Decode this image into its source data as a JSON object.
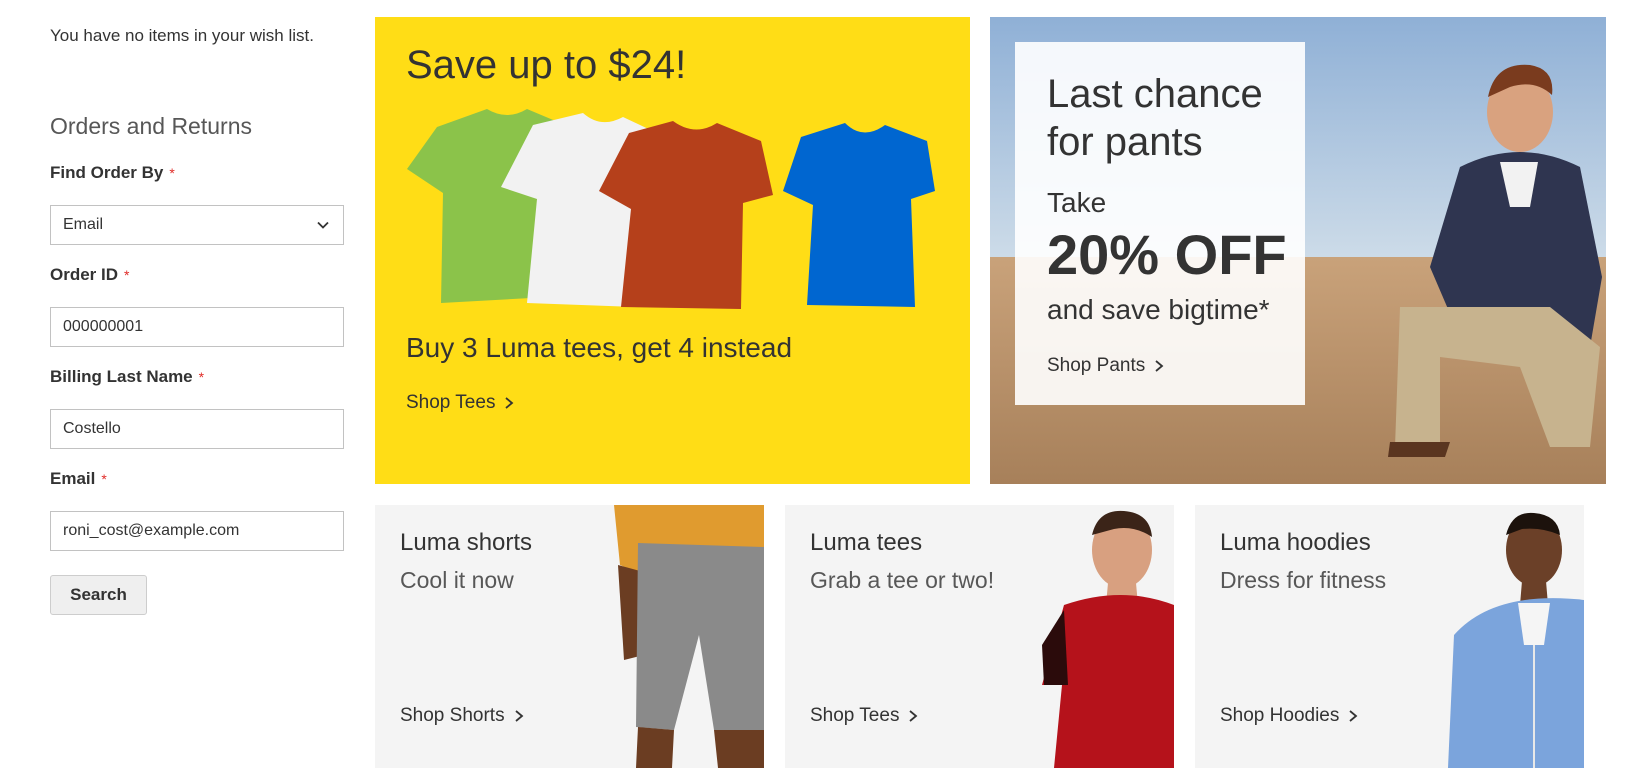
{
  "sidebar": {
    "wishlist_empty": "You have no items in your wish list.",
    "orders_returns_title": "Orders and Returns",
    "required_mark": "*",
    "fields": {
      "find_order_by": {
        "label": "Find Order By",
        "value": "Email"
      },
      "order_id": {
        "label": "Order ID",
        "value": "000000001"
      },
      "billing_last_name": {
        "label": "Billing Last Name",
        "value": "Costello"
      },
      "email": {
        "label": "Email",
        "value": "roni_cost@example.com"
      }
    },
    "search_label": "Search"
  },
  "promos": {
    "tees": {
      "title": "Save up to $24!",
      "subtitle": "Buy 3 Luma tees, get 4 instead",
      "link": "Shop Tees",
      "background": "#ffdd16",
      "shirt_colors": [
        "#8bc34a",
        "#f2f2f2",
        "#b5401b",
        "#0066d0"
      ]
    },
    "pants": {
      "title": "Last chance for pants",
      "take": "Take",
      "discount": "20% OFF",
      "save": "and save bigtime*",
      "link": "Shop Pants"
    },
    "shorts": {
      "title": "Luma shorts",
      "subtitle": "Cool it now",
      "link": "Shop Shorts"
    },
    "tees_small": {
      "title": "Luma tees",
      "subtitle": "Grab a tee or two!",
      "link": "Shop Tees"
    },
    "hoodies": {
      "title": "Luma hoodies",
      "subtitle": "Dress for fitness",
      "link": "Shop Hoodies"
    }
  },
  "colors": {
    "required": "#e02b27",
    "text": "#333333",
    "muted": "#575757",
    "panel": "#f4f4f4"
  }
}
